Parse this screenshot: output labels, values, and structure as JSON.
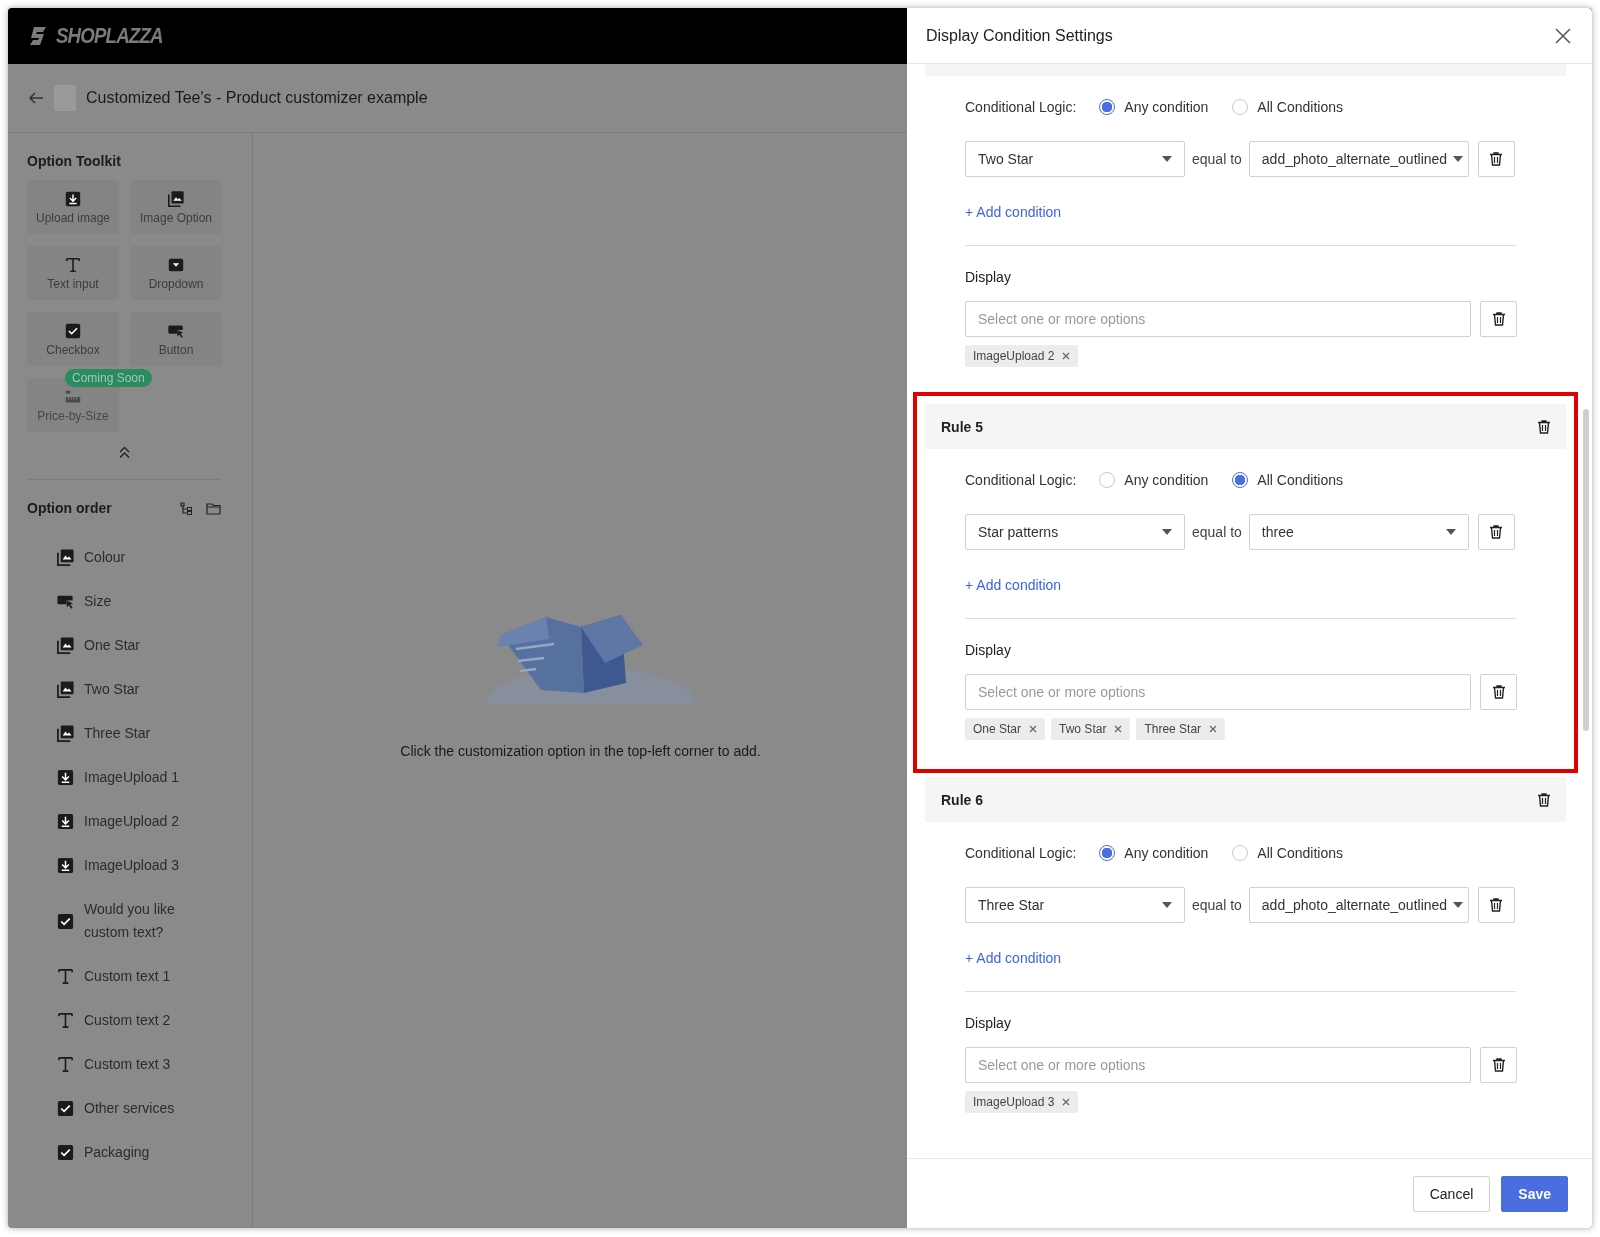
{
  "header": {
    "logo": "SHOPLAZZA"
  },
  "page": {
    "title": "Customized Tee's - Product customizer example"
  },
  "toolkit": {
    "title": "Option Toolkit",
    "tools": [
      {
        "label": "Upload image",
        "kind": "upload",
        "disabled": false
      },
      {
        "label": "Image Option",
        "kind": "image",
        "disabled": false
      },
      {
        "label": "Text input",
        "kind": "text",
        "disabled": false
      },
      {
        "label": "Dropdown",
        "kind": "dropdown",
        "disabled": false
      },
      {
        "label": "Checkbox",
        "kind": "checkbox",
        "disabled": false
      },
      {
        "label": "Button",
        "kind": "button",
        "disabled": false
      },
      {
        "label": "Price-by-Size",
        "kind": "ruler",
        "disabled": true,
        "badge": "Coming Soon"
      }
    ]
  },
  "option_order": {
    "title": "Option order",
    "items": [
      {
        "label": "Colour",
        "kind": "image"
      },
      {
        "label": "Size",
        "kind": "button"
      },
      {
        "label": "One Star",
        "kind": "image"
      },
      {
        "label": "Two Star",
        "kind": "image"
      },
      {
        "label": "Three Star",
        "kind": "image"
      },
      {
        "label": "ImageUpload 1",
        "kind": "upload"
      },
      {
        "label": "ImageUpload 2",
        "kind": "upload"
      },
      {
        "label": "ImageUpload 3",
        "kind": "upload"
      },
      {
        "label": "Would you like custom text?",
        "kind": "checkbox"
      },
      {
        "label": "Custom text 1",
        "kind": "text"
      },
      {
        "label": "Custom text 2",
        "kind": "text"
      },
      {
        "label": "Custom text 3",
        "kind": "text"
      },
      {
        "label": "Other services",
        "kind": "checkbox"
      },
      {
        "label": "Packaging",
        "kind": "checkbox"
      }
    ]
  },
  "canvas": {
    "empty_message": "Click the customization option in the top-left corner to add."
  },
  "drawer": {
    "title": "Display Condition Settings",
    "rules": [
      {
        "highlighted": false,
        "logic_label": "Conditional Logic:",
        "logic_options": [
          {
            "label": "Any condition",
            "selected": true
          },
          {
            "label": "All Conditions",
            "selected": false
          }
        ],
        "conditions": [
          {
            "field": "Two Star",
            "operator": "equal to",
            "value": "add_photo_alternate_outlined"
          }
        ],
        "add_label": "+ Add condition",
        "display_label": "Display",
        "display_placeholder": "Select one or more options",
        "display_tags": [
          "ImageUpload 2"
        ]
      },
      {
        "title": "Rule 5",
        "highlighted": true,
        "logic_label": "Conditional Logic:",
        "logic_options": [
          {
            "label": "Any condition",
            "selected": false
          },
          {
            "label": "All Conditions",
            "selected": true
          }
        ],
        "conditions": [
          {
            "field": "Star patterns",
            "operator": "equal to",
            "value": "three"
          }
        ],
        "add_label": "+ Add condition",
        "display_label": "Display",
        "display_placeholder": "Select one or more options",
        "display_tags": [
          "One Star",
          "Two Star",
          "Three Star"
        ]
      },
      {
        "title": "Rule 6",
        "highlighted": false,
        "logic_label": "Conditional Logic:",
        "logic_options": [
          {
            "label": "Any condition",
            "selected": true
          },
          {
            "label": "All Conditions",
            "selected": false
          }
        ],
        "conditions": [
          {
            "field": "Three Star",
            "operator": "equal to",
            "value": "add_photo_alternate_outlined"
          }
        ],
        "add_label": "+ Add condition",
        "display_label": "Display",
        "display_placeholder": "Select one or more options",
        "display_tags": [
          "ImageUpload 3"
        ]
      }
    ],
    "buttons": [
      {
        "label": "Cancel",
        "kind": "secondary"
      },
      {
        "label": "Save",
        "kind": "primary"
      }
    ]
  }
}
